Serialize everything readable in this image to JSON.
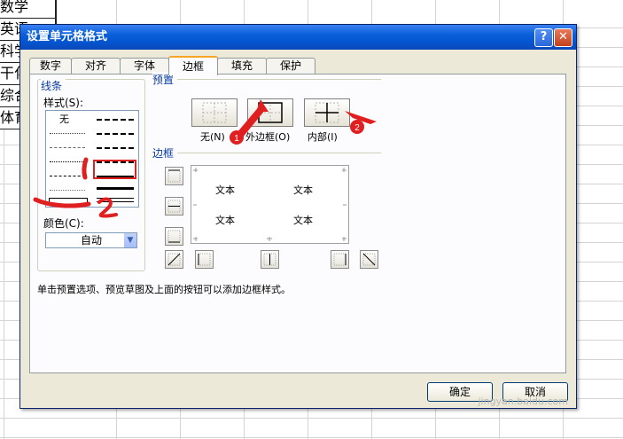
{
  "sheet": {
    "cells": [
      "数学",
      "英语",
      "科学",
      "干化",
      "综合",
      "体育"
    ]
  },
  "dialog": {
    "title": "设置单元格格式",
    "help_glyph": "?",
    "close_glyph": "✕",
    "tabs": [
      {
        "label": "数字"
      },
      {
        "label": "对齐"
      },
      {
        "label": "字体"
      },
      {
        "label": "边框"
      },
      {
        "label": "填充"
      },
      {
        "label": "保护"
      }
    ],
    "active_tab": "边框",
    "line": {
      "group_title": "线条",
      "style_label": "样式(S):",
      "none_label": "无",
      "color_label": "颜色(C):",
      "color_value": "自动"
    },
    "presets": {
      "group_title": "预置",
      "none_label": "无(N)",
      "outline_label": "外边框(O)",
      "inside_label": "内部(I)"
    },
    "border": {
      "group_title": "边框",
      "preview_text": [
        "文本",
        "文本",
        "文本",
        "文本"
      ]
    },
    "hint": "单击预置选项、预览草图及上面的按钮可以添加边框样式。",
    "ok_label": "确定",
    "cancel_label": "取消"
  },
  "annotations": {
    "badge_1": "1",
    "badge_2": "2"
  },
  "watermark": "jingyan.baidu.com",
  "colors": {
    "accent": "#f6a526",
    "title_bar": "#0a5fd8",
    "annotation_red": "#e02020"
  }
}
